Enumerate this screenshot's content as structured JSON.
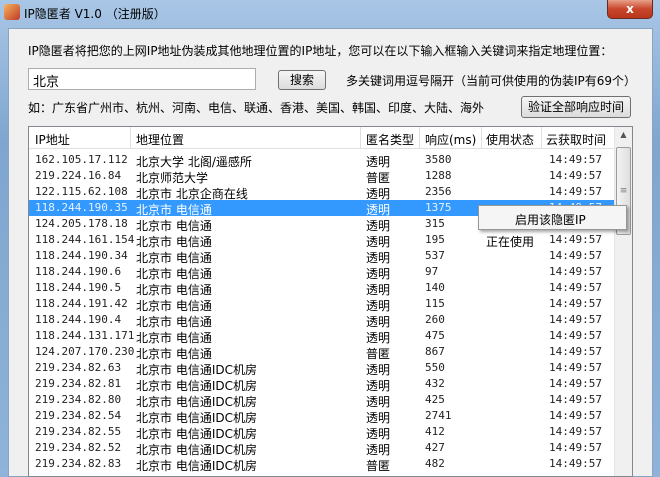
{
  "window": {
    "title": "IP隐匿者 V1.0 （注册版）",
    "close": "x"
  },
  "description": "IP隐匿者将把您的上网IP地址伪装成其他地理位置的IP地址，您可以在以下输入框输入关键词来指定地理位置：",
  "search": {
    "value": "北京",
    "button": "搜索",
    "hint": "多关键词用逗号隔开（当前可供使用的伪装IP有69个）"
  },
  "example": "如：广东省广州市、杭州、河南、电信、联通、香港、美国、韩国、印度、大陆、海外",
  "verify_button": "验证全部响应时间",
  "table": {
    "columns": [
      "IP地址",
      "地理位置",
      "匿名类型",
      "响应(ms)",
      "使用状态",
      "云获取时间"
    ],
    "rows": [
      [
        "162.105.17.112",
        "北京大学 北阁/遥感所",
        "透明",
        "3580",
        "",
        "14:49:57"
      ],
      [
        "219.224.16.84",
        "北京师范大学",
        "普匿",
        "1288",
        "",
        "14:49:57"
      ],
      [
        "122.115.62.108",
        "北京市 北京企商在线",
        "透明",
        "2356",
        "",
        "14:49:57"
      ],
      [
        "118.244.190.35",
        "北京市 电信通",
        "透明",
        "1375",
        "",
        "14:49:57"
      ],
      [
        "124.205.178.18",
        "北京市 电信通",
        "透明",
        "315",
        "",
        "14:49:57"
      ],
      [
        "118.244.161.154",
        "北京市 电信通",
        "透明",
        "195",
        "正在使用",
        "14:49:57"
      ],
      [
        "118.244.190.34",
        "北京市 电信通",
        "透明",
        "537",
        "",
        "14:49:57"
      ],
      [
        "118.244.190.6",
        "北京市 电信通",
        "透明",
        "97",
        "",
        "14:49:57"
      ],
      [
        "118.244.190.5",
        "北京市 电信通",
        "透明",
        "140",
        "",
        "14:49:57"
      ],
      [
        "118.244.191.42",
        "北京市 电信通",
        "透明",
        "115",
        "",
        "14:49:57"
      ],
      [
        "118.244.190.4",
        "北京市 电信通",
        "透明",
        "260",
        "",
        "14:49:57"
      ],
      [
        "118.244.131.171",
        "北京市 电信通",
        "透明",
        "475",
        "",
        "14:49:57"
      ],
      [
        "124.207.170.230",
        "北京市 电信通",
        "普匿",
        "867",
        "",
        "14:49:57"
      ],
      [
        "219.234.82.63",
        "北京市 电信通IDC机房",
        "透明",
        "550",
        "",
        "14:49:57"
      ],
      [
        "219.234.82.81",
        "北京市 电信通IDC机房",
        "透明",
        "432",
        "",
        "14:49:57"
      ],
      [
        "219.234.82.80",
        "北京市 电信通IDC机房",
        "透明",
        "425",
        "",
        "14:49:57"
      ],
      [
        "219.234.82.54",
        "北京市 电信通IDC机房",
        "透明",
        "2741",
        "",
        "14:49:57"
      ],
      [
        "219.234.82.55",
        "北京市 电信通IDC机房",
        "透明",
        "412",
        "",
        "14:49:57"
      ],
      [
        "219.234.82.52",
        "北京市 电信通IDC机房",
        "透明",
        "427",
        "",
        "14:49:57"
      ],
      [
        "219.234.82.83",
        "北京市 电信通IDC机房",
        "普匿",
        "482",
        "",
        "14:49:57"
      ]
    ],
    "selected_index": 3
  },
  "context_menu": {
    "item": "启用该隐匿IP"
  }
}
